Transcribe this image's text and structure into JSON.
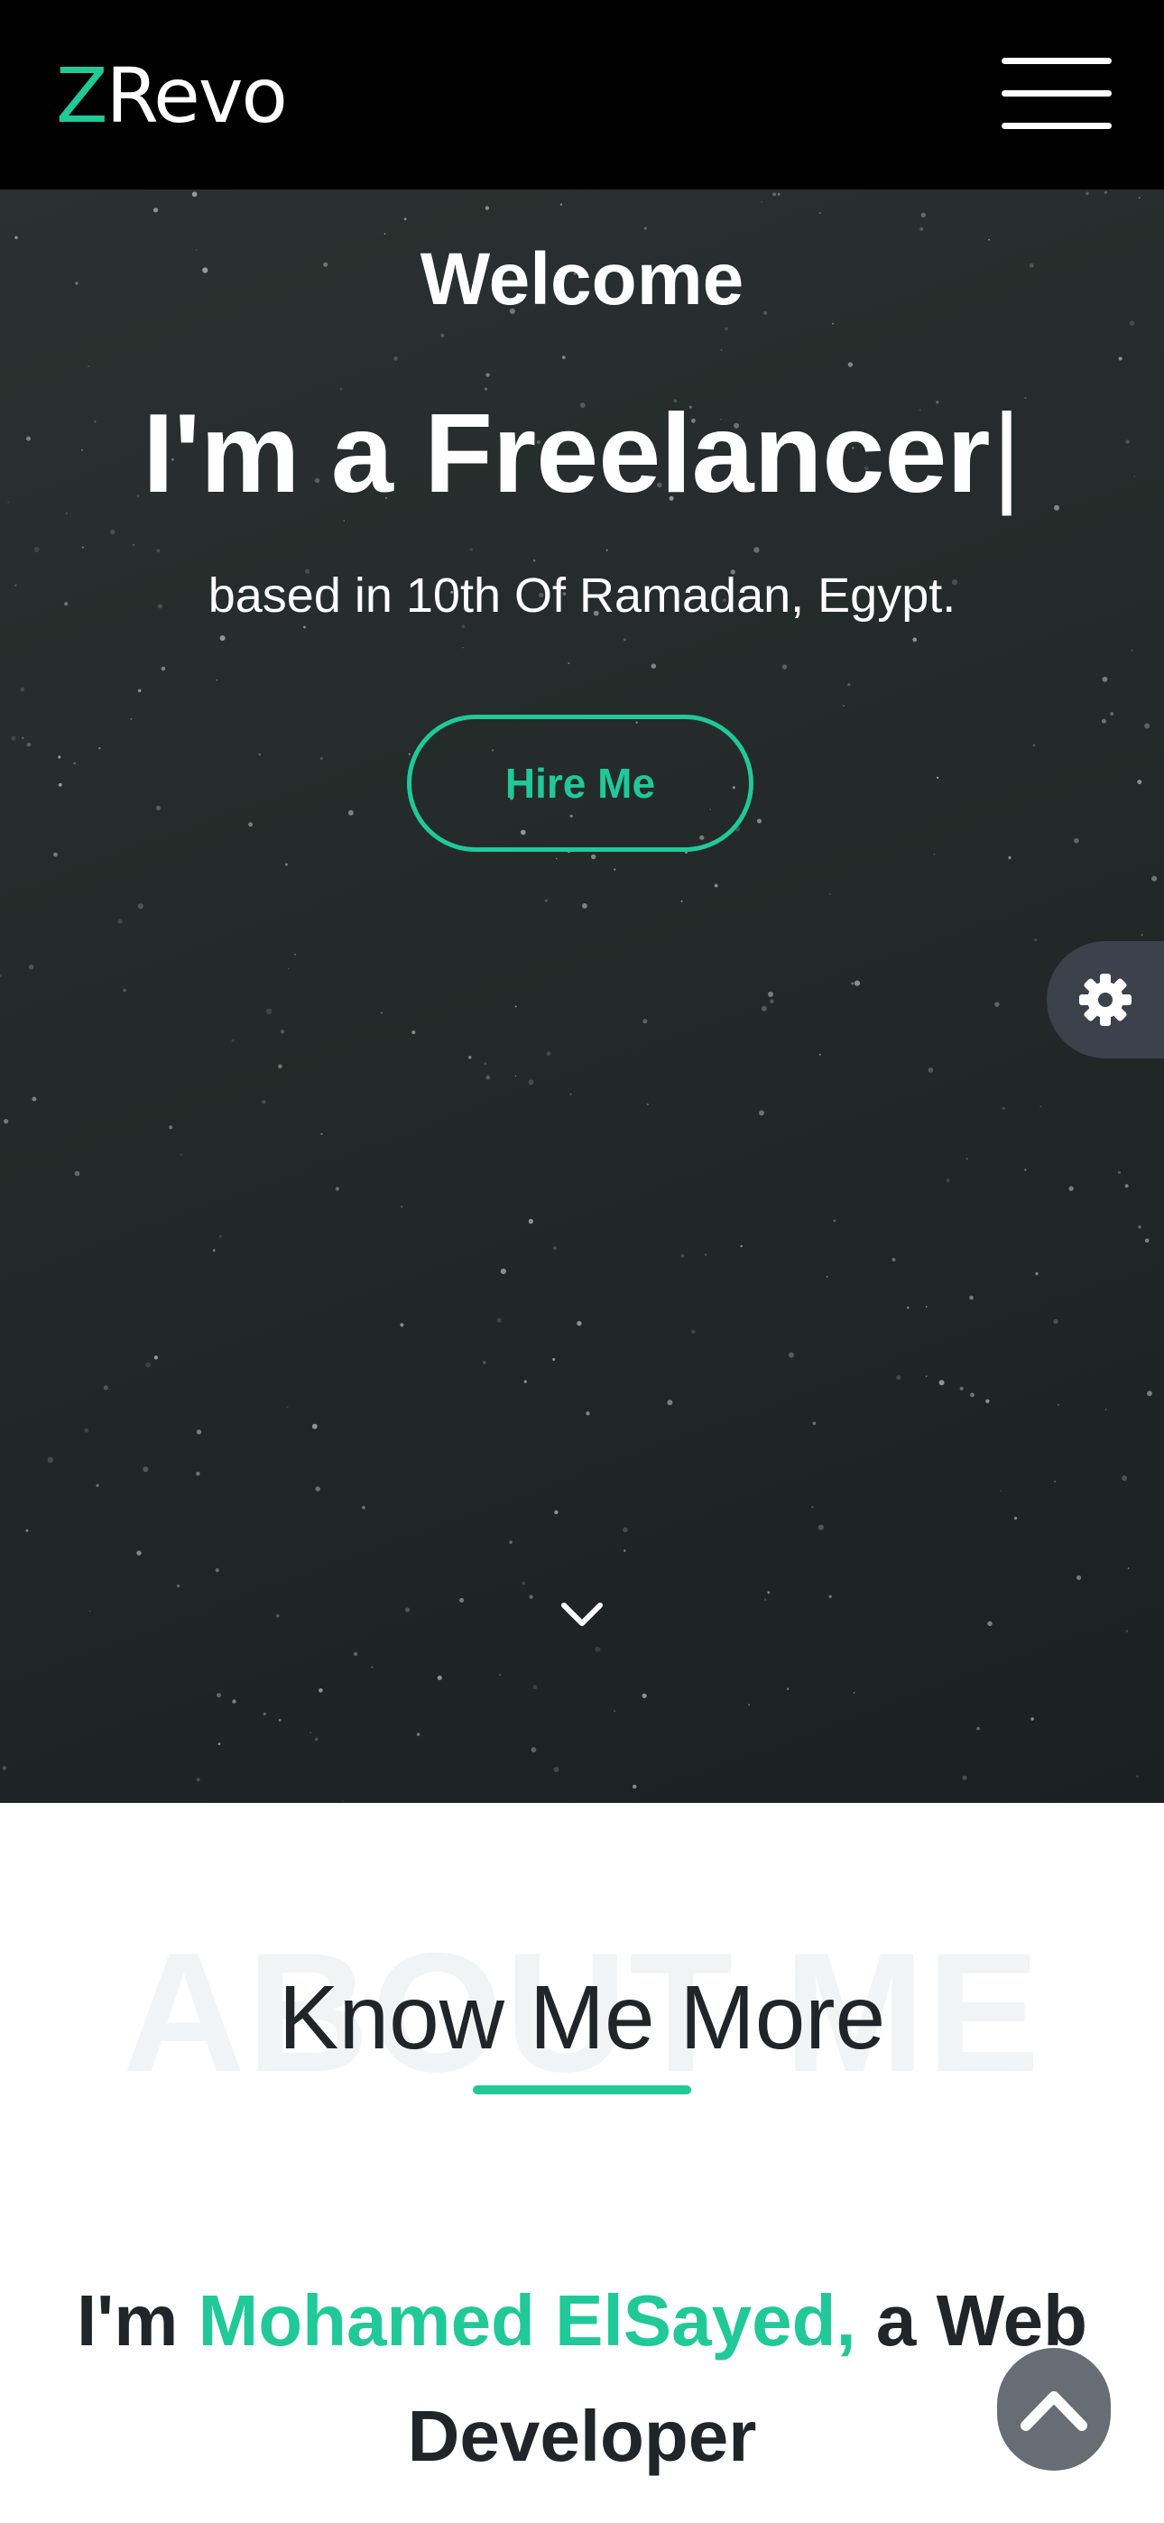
{
  "header": {
    "logo_initial": "Z",
    "logo_rest": "Revo",
    "menu_icon": "hamburger-icon"
  },
  "hero": {
    "welcome": "Welcome",
    "headline": "I'm a Freelancer",
    "cursor": "|",
    "location": "based in 10th Of Ramadan, Egypt.",
    "hire_label": "Hire Me",
    "scroll_icon": "chevron-down-icon"
  },
  "settings": {
    "icon": "gear-icon"
  },
  "about": {
    "watermark": "ABOUT ME",
    "title": "Know Me More",
    "intro_prefix": "I'm ",
    "intro_name": "Mohamed ElSayed,",
    "intro_suffix": " a Web Developer"
  },
  "back_to_top": {
    "icon": "chevron-up-icon"
  },
  "colors": {
    "accent": "#20c997",
    "header_bg": "#000000",
    "hero_bg": "#232a29",
    "text_dark": "#212529",
    "settings_bg": "#3b424c",
    "back_to_top_bg": "#666d74"
  }
}
